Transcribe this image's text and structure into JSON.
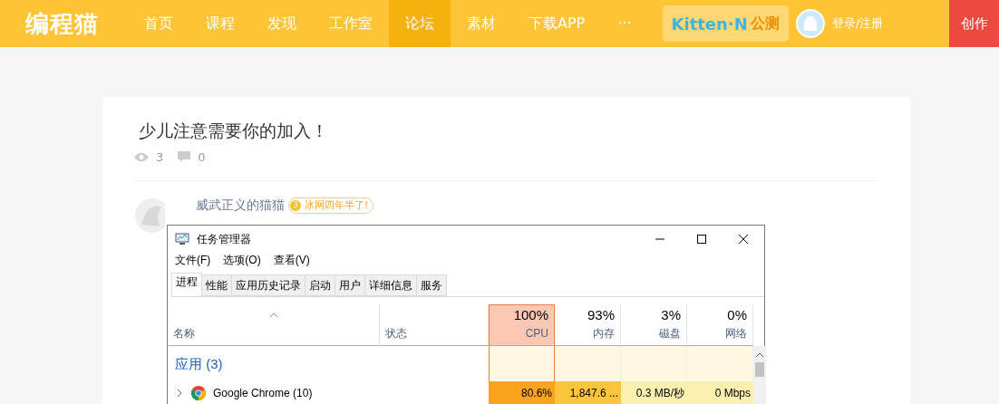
{
  "header": {
    "logo": "编程猫",
    "nav": [
      {
        "label": "首页",
        "selected": false
      },
      {
        "label": "课程",
        "selected": false
      },
      {
        "label": "发现",
        "selected": false
      },
      {
        "label": "工作室",
        "selected": false
      },
      {
        "label": "论坛",
        "selected": true
      },
      {
        "label": "素材",
        "selected": false
      },
      {
        "label": "下载APP",
        "selected": false
      }
    ],
    "more": "···",
    "promo": {
      "brand": "Kitten·N",
      "tag": "公测"
    },
    "login": "登录/注册",
    "create_button": "创作"
  },
  "post": {
    "title": "少儿注意需要你的加入！",
    "views": "3",
    "comments": "0",
    "author": {
      "name": "威武正义的猫猫",
      "badge_level": "3",
      "badge_text": "冰网四年半了!"
    }
  },
  "task_manager": {
    "title": "任务管理器",
    "menu": [
      "文件(F)",
      "选项(O)",
      "查看(V)"
    ],
    "tabs": [
      {
        "label": "进程",
        "selected": true
      },
      {
        "label": "性能",
        "selected": false
      },
      {
        "label": "应用历史记录",
        "selected": false
      },
      {
        "label": "启动",
        "selected": false
      },
      {
        "label": "用户",
        "selected": false
      },
      {
        "label": "详细信息",
        "selected": false
      },
      {
        "label": "服务",
        "selected": false
      }
    ],
    "name_column": "名称",
    "status_column": "状态",
    "metrics": [
      {
        "usage": "100%",
        "label": "CPU",
        "selected": true
      },
      {
        "usage": "93%",
        "label": "内存",
        "selected": false
      },
      {
        "usage": "3%",
        "label": "磁盘",
        "selected": false
      },
      {
        "usage": "0%",
        "label": "网络",
        "selected": false
      }
    ],
    "group": "应用 (3)",
    "rows": [
      {
        "name": "Google Chrome (10)",
        "expanded": false,
        "cells": [
          {
            "value": "80.6%",
            "color": "#f9a41c"
          },
          {
            "value": "1,847.6 ...",
            "color": "#fcc53c"
          },
          {
            "value": "0.3 MB/秒",
            "color": "#fbefb0"
          },
          {
            "value": "0 Mbps",
            "color": "#fbefb0"
          }
        ]
      }
    ]
  }
}
